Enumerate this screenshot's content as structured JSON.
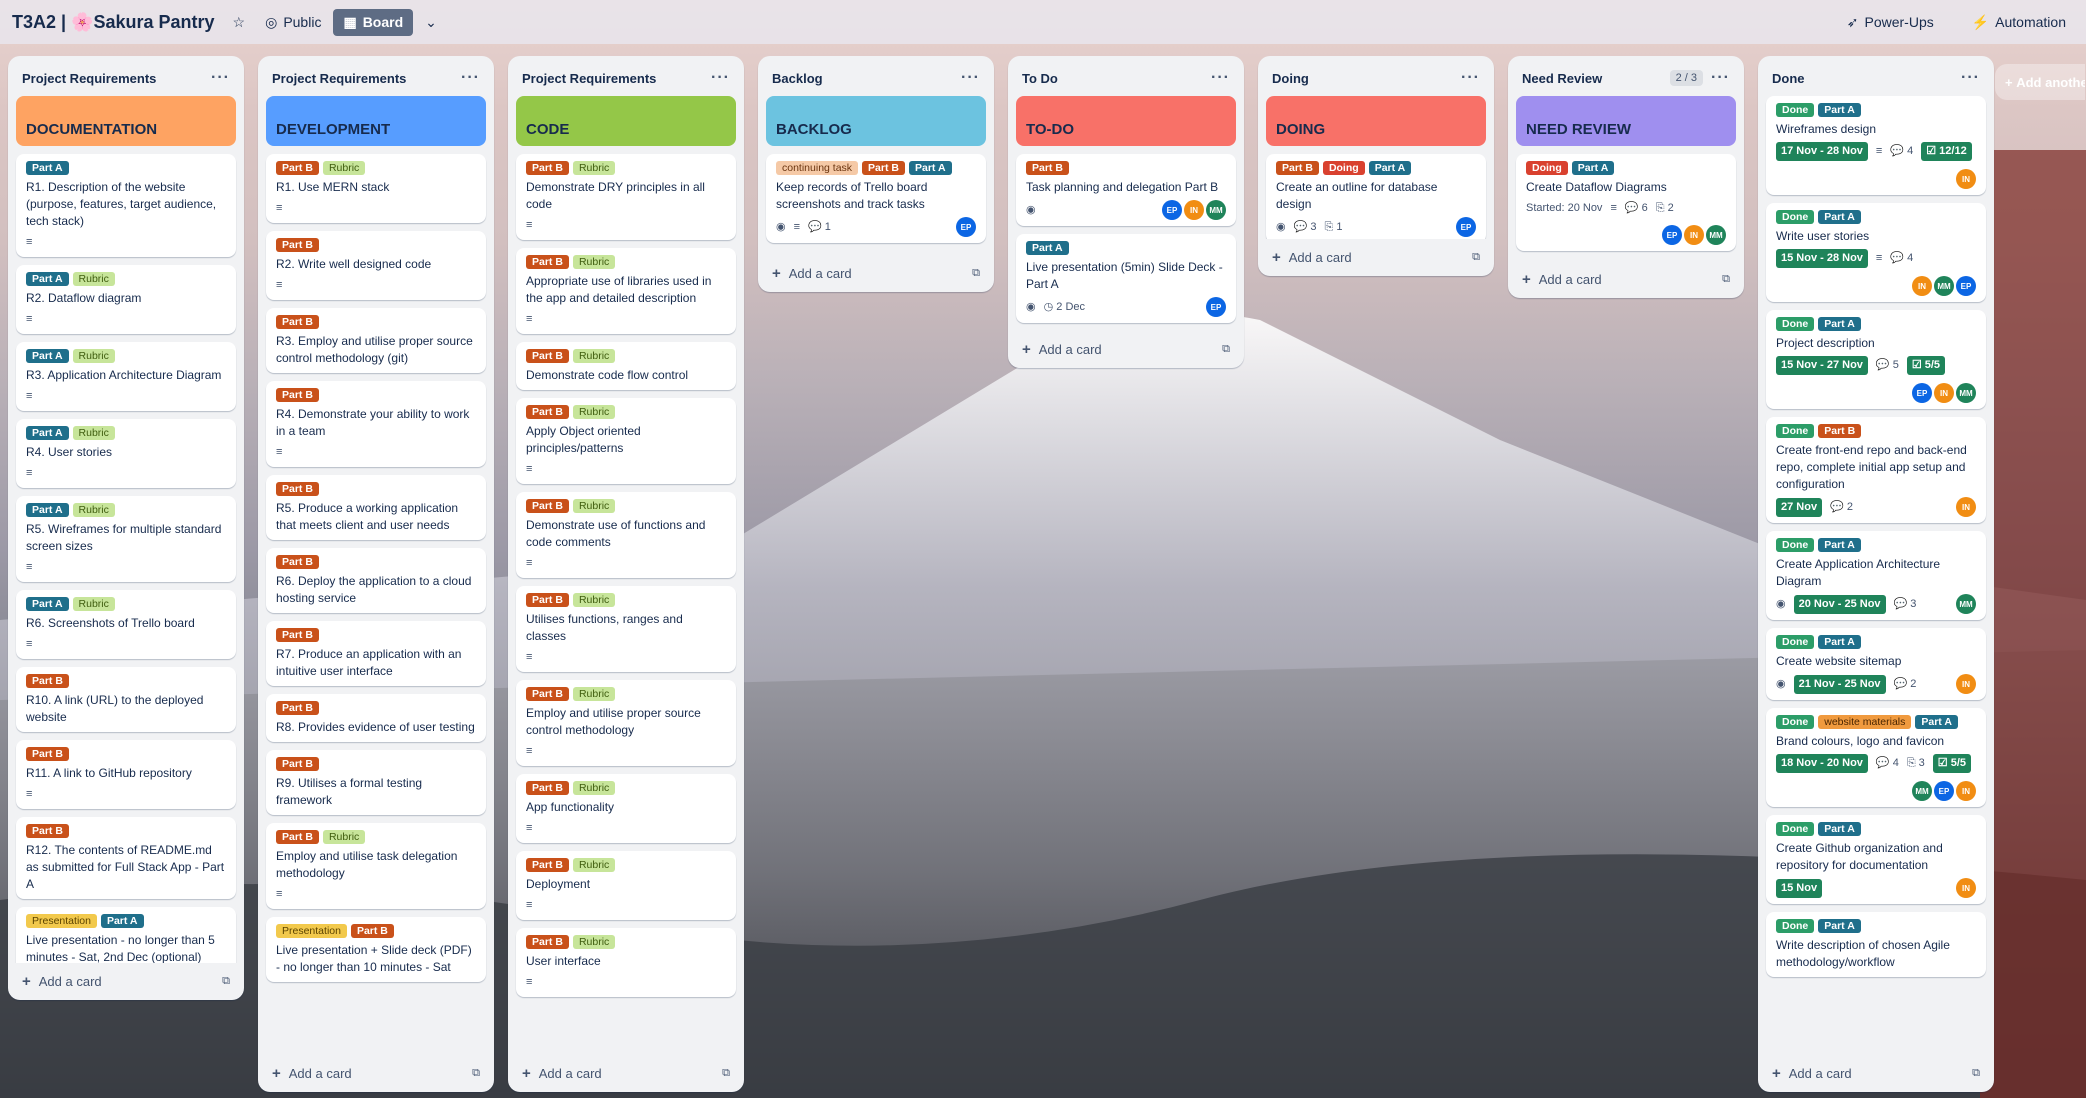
{
  "header": {
    "title": "T3A2 | 🌸Sakura Pantry",
    "visibility": "Public",
    "view": "Board",
    "powerups": "Power-Ups",
    "automation": "Automation"
  },
  "add_another_list": "Add another list",
  "add_card_label": "Add a card",
  "lists": [
    {
      "name": "Project Requirements",
      "cover": {
        "title": "DOCUMENTATION",
        "color": "#fea362"
      },
      "cards": [
        {
          "labels": [
            "Part A"
          ],
          "title": "R1. Description of the website (purpose, features, target audience, tech stack)",
          "desc": true
        },
        {
          "labels": [
            "Part A",
            "Rubric"
          ],
          "title": "R2. Dataflow diagram",
          "desc": true
        },
        {
          "labels": [
            "Part A",
            "Rubric"
          ],
          "title": "R3. Application Architecture Diagram",
          "desc": true
        },
        {
          "labels": [
            "Part A",
            "Rubric"
          ],
          "title": "R4. User stories",
          "desc": true
        },
        {
          "labels": [
            "Part A",
            "Rubric"
          ],
          "title": "R5. Wireframes for multiple standard screen sizes",
          "desc": true
        },
        {
          "labels": [
            "Part A",
            "Rubric"
          ],
          "title": "R6. Screenshots of Trello board",
          "desc": true
        },
        {
          "labels": [
            "Part B"
          ],
          "title": "R10. A link (URL) to the deployed website",
          "desc": false
        },
        {
          "labels": [
            "Part B"
          ],
          "title": "R11. A link to GitHub repository",
          "desc": true
        },
        {
          "labels": [
            "Part B"
          ],
          "title": "R12. The contents of README.md as submitted for Full Stack App - Part A",
          "desc": false
        },
        {
          "labels": [
            "Presentation",
            "Part A"
          ],
          "title": "Live presentation - no longer than 5 minutes - Sat, 2nd Dec (optional)",
          "desc": false
        }
      ]
    },
    {
      "name": "Project Requirements",
      "cover": {
        "title": "DEVELOPMENT",
        "color": "#579dff"
      },
      "cards": [
        {
          "labels": [
            "Part B",
            "Rubric"
          ],
          "title": "R1. Use MERN stack",
          "desc": true
        },
        {
          "labels": [
            "Part B"
          ],
          "title": "R2. Write well designed code",
          "desc": true
        },
        {
          "labels": [
            "Part B"
          ],
          "title": "R3. Employ and utilise proper source control methodology (git)",
          "desc": false
        },
        {
          "labels": [
            "Part B"
          ],
          "title": "R4. Demonstrate your ability to work in a team",
          "desc": true
        },
        {
          "labels": [
            "Part B"
          ],
          "title": "R5. Produce a working application that meets client and user needs",
          "desc": false
        },
        {
          "labels": [
            "Part B"
          ],
          "title": "R6. Deploy the application to a cloud hosting service",
          "desc": false
        },
        {
          "labels": [
            "Part B"
          ],
          "title": "R7. Produce an application with an intuitive user interface",
          "desc": false
        },
        {
          "labels": [
            "Part B"
          ],
          "title": "R8. Provides evidence of user testing",
          "desc": false
        },
        {
          "labels": [
            "Part B"
          ],
          "title": "R9. Utilises a formal testing framework",
          "desc": false
        },
        {
          "labels": [
            "Part B",
            "Rubric"
          ],
          "title": "Employ and utilise task delegation methodology",
          "desc": true
        },
        {
          "labels": [
            "Presentation",
            "Part B"
          ],
          "title": "Live presentation + Slide deck (PDF) - no longer than 10 minutes - Sat",
          "desc": false
        }
      ]
    },
    {
      "name": "Project Requirements",
      "cover": {
        "title": "CODE",
        "color": "#94c748"
      },
      "cards": [
        {
          "labels": [
            "Part B",
            "Rubric"
          ],
          "title": "Demonstrate DRY principles in all code",
          "desc": true
        },
        {
          "labels": [
            "Part B",
            "Rubric"
          ],
          "title": "Appropriate use of libraries used in the app and detailed description",
          "desc": true
        },
        {
          "labels": [
            "Part B",
            "Rubric"
          ],
          "title": "Demonstrate code flow control",
          "desc": false
        },
        {
          "labels": [
            "Part B",
            "Rubric"
          ],
          "title": "Apply Object oriented principles/patterns",
          "desc": true
        },
        {
          "labels": [
            "Part B",
            "Rubric"
          ],
          "title": "Demonstrate use of functions and code comments",
          "desc": true
        },
        {
          "labels": [
            "Part B",
            "Rubric"
          ],
          "title": "Utilises functions, ranges and classes",
          "desc": true
        },
        {
          "labels": [
            "Part B",
            "Rubric"
          ],
          "title": "Employ and utilise proper source control methodology",
          "desc": true
        },
        {
          "labels": [
            "Part B",
            "Rubric"
          ],
          "title": "App functionality",
          "desc": true
        },
        {
          "labels": [
            "Part B",
            "Rubric"
          ],
          "title": "Deployment",
          "desc": true
        },
        {
          "labels": [
            "Part B",
            "Rubric"
          ],
          "title": "User interface",
          "desc": true
        }
      ]
    },
    {
      "name": "Backlog",
      "cover": {
        "title": "BACKLOG",
        "color": "#6cc3e0"
      },
      "cards": [
        {
          "labels": [
            "continuing task",
            "Part B",
            "Part A"
          ],
          "title": "Keep records of Trello board screenshots and track tasks",
          "watch": true,
          "desc": true,
          "comments": "1",
          "members": [
            "EP"
          ]
        }
      ]
    },
    {
      "name": "To Do",
      "cover": {
        "title": "TO-DO",
        "color": "#f87168"
      },
      "cards": [
        {
          "labels": [
            "Part B"
          ],
          "title": "Task planning and delegation Part B",
          "watch": true,
          "members": [
            "EP",
            "IN",
            "MM"
          ]
        },
        {
          "labels": [
            "Part A"
          ],
          "title": "Live presentation (5min) Slide Deck - Part A",
          "watch": true,
          "date_plain": "2 Dec",
          "members": [
            "EP"
          ]
        }
      ]
    },
    {
      "name": "Doing",
      "cover": {
        "title": "DOING",
        "color": "#f87168"
      },
      "cards": [
        {
          "labels": [
            "Part B",
            "Doing",
            "Part A"
          ],
          "title": "Create an outline for database design",
          "watch": true,
          "comments": "3",
          "attachments": "1",
          "members": [
            "EP"
          ]
        }
      ]
    },
    {
      "name": "Need Review",
      "count": "2 / 3",
      "cover": {
        "title": "NEED REVIEW",
        "color": "#9f8fef"
      },
      "cards": [
        {
          "labels": [
            "Doing",
            "Part A"
          ],
          "title": "Create Dataflow Diagrams",
          "started": "Started: 20 Nov",
          "desc": true,
          "comments": "6",
          "attachments": "2",
          "members": [
            "EP",
            "IN",
            "MM"
          ]
        }
      ]
    },
    {
      "name": "Done",
      "cards": [
        {
          "labels": [
            "Done",
            "Part A"
          ],
          "title": "Wireframes design",
          "date": "17 Nov - 28 Nov",
          "desc": true,
          "comments": "4",
          "checklist": "12/12",
          "members": [
            "IN"
          ]
        },
        {
          "labels": [
            "Done",
            "Part A"
          ],
          "title": "Write user stories",
          "date": "15 Nov - 28 Nov",
          "desc": true,
          "comments": "4",
          "members": [
            "IN",
            "MM",
            "EP"
          ]
        },
        {
          "labels": [
            "Done",
            "Part A"
          ],
          "title": "Project description",
          "date": "15 Nov - 27 Nov",
          "comments": "5",
          "checklist": "5/5",
          "members": [
            "EP",
            "IN",
            "MM"
          ]
        },
        {
          "labels": [
            "Done",
            "Part B"
          ],
          "title": "Create front-end repo and back-end repo, complete initial app setup and configuration",
          "date": "27 Nov",
          "comments": "2",
          "members": [
            "IN"
          ]
        },
        {
          "labels": [
            "Done",
            "Part A"
          ],
          "title": "Create Application Architecture Diagram",
          "watch": true,
          "date": "20 Nov - 25 Nov",
          "comments": "3",
          "members": [
            "MM"
          ]
        },
        {
          "labels": [
            "Done",
            "Part A"
          ],
          "title": "Create website sitemap",
          "watch": true,
          "date": "21 Nov - 25 Nov",
          "comments": "2",
          "members": [
            "IN"
          ]
        },
        {
          "labels": [
            "Done",
            "website materials",
            "Part A"
          ],
          "title": "Brand colours, logo and favicon",
          "date": "18 Nov - 20 Nov",
          "comments": "4",
          "attachments": "3",
          "checklist": "5/5",
          "members": [
            "MM",
            "EP",
            "IN"
          ]
        },
        {
          "labels": [
            "Done",
            "Part A"
          ],
          "title": "Create Github organization and repository for documentation",
          "date": "15 Nov",
          "members": [
            "IN"
          ]
        },
        {
          "labels": [
            "Done",
            "Part A"
          ],
          "title": "Write description of chosen Agile methodology/workflow"
        }
      ]
    }
  ],
  "label_classes": {
    "Part A": "partA",
    "Part B": "partB",
    "Rubric": "rubric",
    "Done": "done",
    "Doing": "doing",
    "Presentation": "presentation",
    "continuing task": "cont",
    "website materials": "webmat"
  },
  "list_heights": [
    944,
    1036,
    1036,
    236,
    312,
    220,
    242,
    1036
  ]
}
